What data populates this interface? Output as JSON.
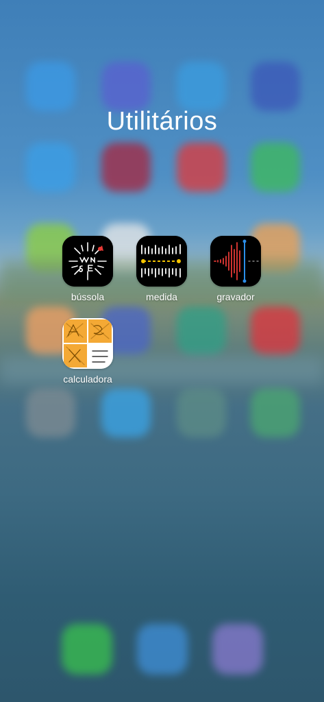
{
  "folder": {
    "title": "Utilitários"
  },
  "apps": [
    {
      "label": "bússola",
      "icon": "compass-icon"
    },
    {
      "label": "medida",
      "icon": "ruler-icon"
    },
    {
      "label": "gravador",
      "icon": "voice-recorder-icon"
    },
    {
      "label": "calculadora",
      "icon": "calculator-icon"
    }
  ]
}
